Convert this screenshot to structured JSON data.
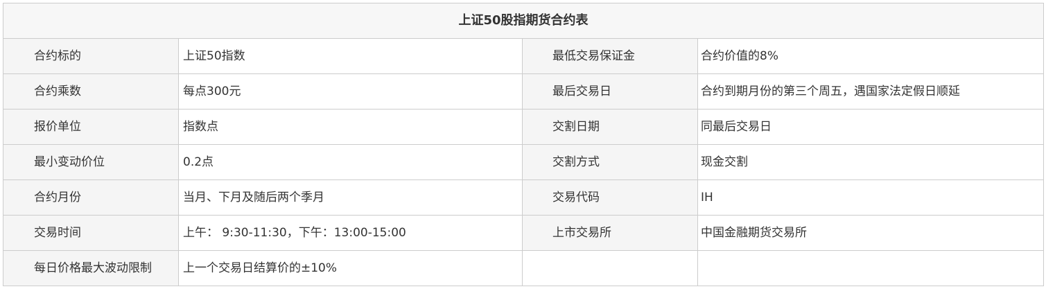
{
  "table": {
    "title": "上证50股指期货合约表",
    "rows": [
      {
        "l1": "合约标的",
        "v1": "上证50指数",
        "l2": "最低交易保证金",
        "v2": "合约价值的8%"
      },
      {
        "l1": "合约乘数",
        "v1": "每点300元",
        "l2": "最后交易日",
        "v2": "合约到期月份的第三个周五，遇国家法定假日顺延"
      },
      {
        "l1": "报价单位",
        "v1": "指数点",
        "l2": "交割日期",
        "v2": "同最后交易日"
      },
      {
        "l1": "最小变动价位",
        "v1": "0.2点",
        "l2": "交割方式",
        "v2": "现金交割"
      },
      {
        "l1": "合约月份",
        "v1": "当月、下月及随后两个季月",
        "l2": "交易代码",
        "v2": "IH"
      },
      {
        "l1": "交易时间",
        "v1": "上午： 9:30-11:30，下午：13:00-15:00",
        "l2": "上市交易所",
        "v2": "中国金融期货交易所"
      },
      {
        "l1": "每日价格最大波动限制",
        "v1": "上一个交易日结算价的±10%",
        "l2": "",
        "v2": ""
      }
    ]
  }
}
